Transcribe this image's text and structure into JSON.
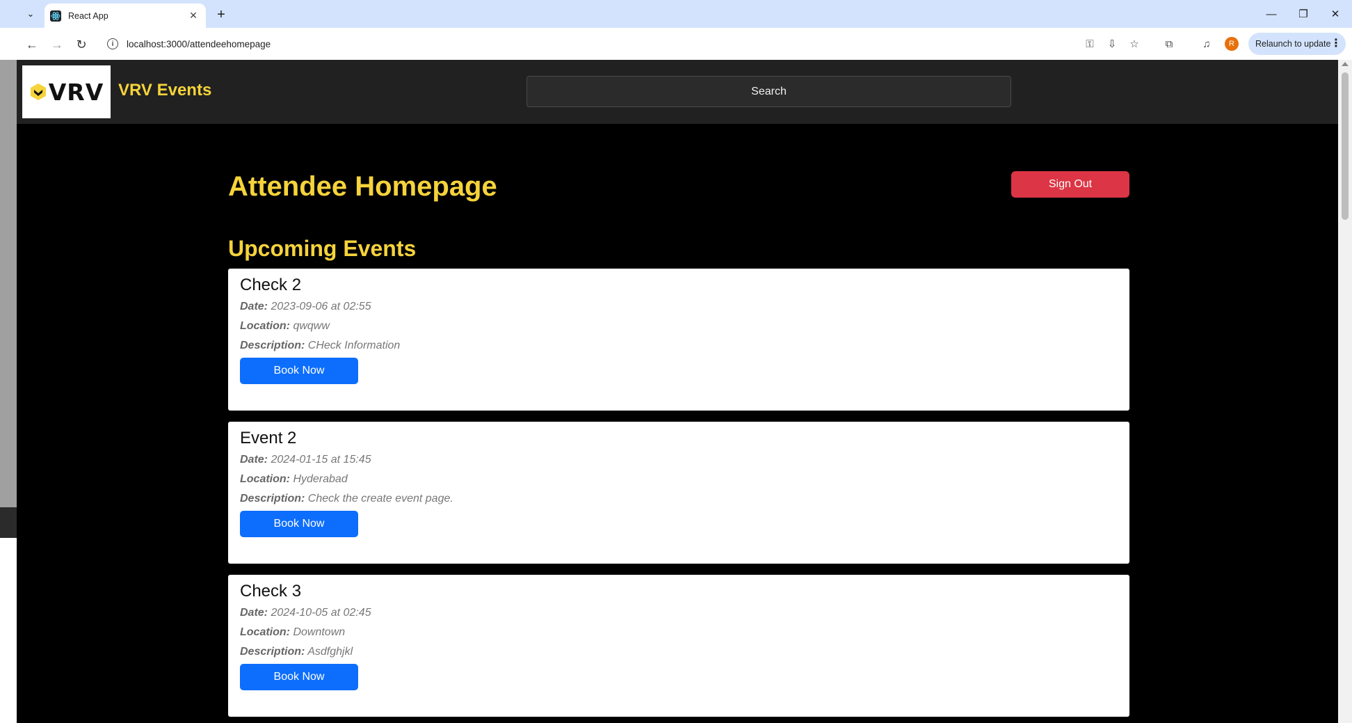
{
  "browser": {
    "tab_title": "React App",
    "url": "localhost:3000/attendeehomepage",
    "relaunch_label": "Relaunch to update",
    "profile_initial": "R"
  },
  "app": {
    "logo_text": "VRV",
    "brand": "VRV Events",
    "search_placeholder": "Search",
    "heading": "Attendee Homepage",
    "signout_label": "Sign Out",
    "subheading": "Upcoming Events",
    "brand_color": "#f5d33b",
    "signout_color": "#dc3545",
    "book_color": "#0d6efd"
  },
  "labels": {
    "date": "Date:",
    "location": "Location:",
    "description": "Description:",
    "book": "Book Now"
  },
  "events": [
    {
      "title": "Check 2",
      "date": "2023-09-06 at 02:55",
      "location": "qwqww",
      "description": "CHeck Information"
    },
    {
      "title": "Event 2",
      "date": "2024-01-15 at 15:45",
      "location": "Hyderabad",
      "description": "Check the create event page."
    },
    {
      "title": "Check 3",
      "date": "2024-10-05 at 02:45",
      "location": "Downtown",
      "description": "Asdfghjkl"
    }
  ]
}
